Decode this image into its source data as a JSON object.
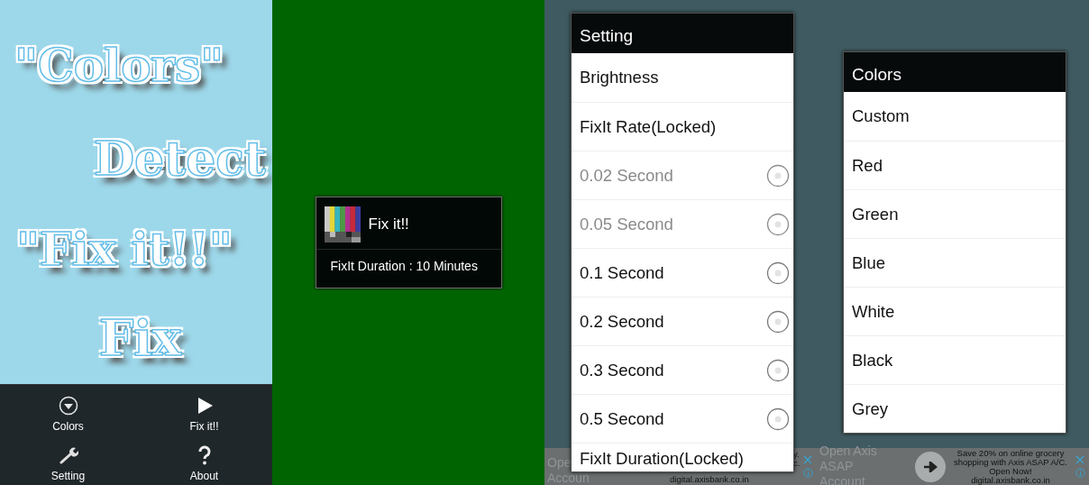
{
  "screens": [
    {
      "kind": "home",
      "logo": [
        "\"Colors\"",
        "Detect",
        "\"Fix it!!\"",
        "Fix"
      ],
      "menu": [
        {
          "label": "Colors"
        },
        {
          "label": "Fix it!!"
        },
        {
          "label": "Setting"
        },
        {
          "label": "About"
        }
      ]
    },
    {
      "kind": "fix_dialog",
      "title": "Fix it!!",
      "message": "FixIt Duration : 10 Minutes"
    },
    {
      "kind": "settings",
      "title": "Setting",
      "ad": {
        "left": [
          "Ope",
          "Accoun"
        ],
        "right": [
          "y.",
          "c."
        ],
        "url": "digital.axisbank.co.in"
      },
      "items": [
        {
          "label": "Brightness",
          "kind": "plain"
        },
        {
          "label": "FixIt Rate(Locked)",
          "kind": "plain"
        },
        {
          "label": "0.02 Second",
          "kind": "radio",
          "selected": false,
          "disabled": true
        },
        {
          "label": "0.05 Second",
          "kind": "radio",
          "selected": false,
          "disabled": true
        },
        {
          "label": "0.1 Second",
          "kind": "radio",
          "selected": false,
          "disabled": false
        },
        {
          "label": "0.2 Second",
          "kind": "radio",
          "selected": false,
          "disabled": false
        },
        {
          "label": "0.3 Second",
          "kind": "radio",
          "selected": false,
          "disabled": false
        },
        {
          "label": "0.5 Second",
          "kind": "radio",
          "selected": false,
          "disabled": false
        },
        {
          "label": "FixIt Duration(Locked)",
          "kind": "plain"
        }
      ]
    },
    {
      "kind": "colors",
      "title": "Colors",
      "ad": {
        "left": [
          "Open Axis ASAP",
          "Account"
        ],
        "lines": [
          "Save 20% on online grocery",
          "shopping with Axis ASAP A/C.",
          "Open Now!"
        ],
        "url": "digital.axisbank.co.in"
      },
      "items": [
        {
          "label": "Custom"
        },
        {
          "label": "Red"
        },
        {
          "label": "Green"
        },
        {
          "label": "Blue"
        },
        {
          "label": "White"
        },
        {
          "label": "Black"
        },
        {
          "label": "Grey"
        }
      ]
    }
  ]
}
